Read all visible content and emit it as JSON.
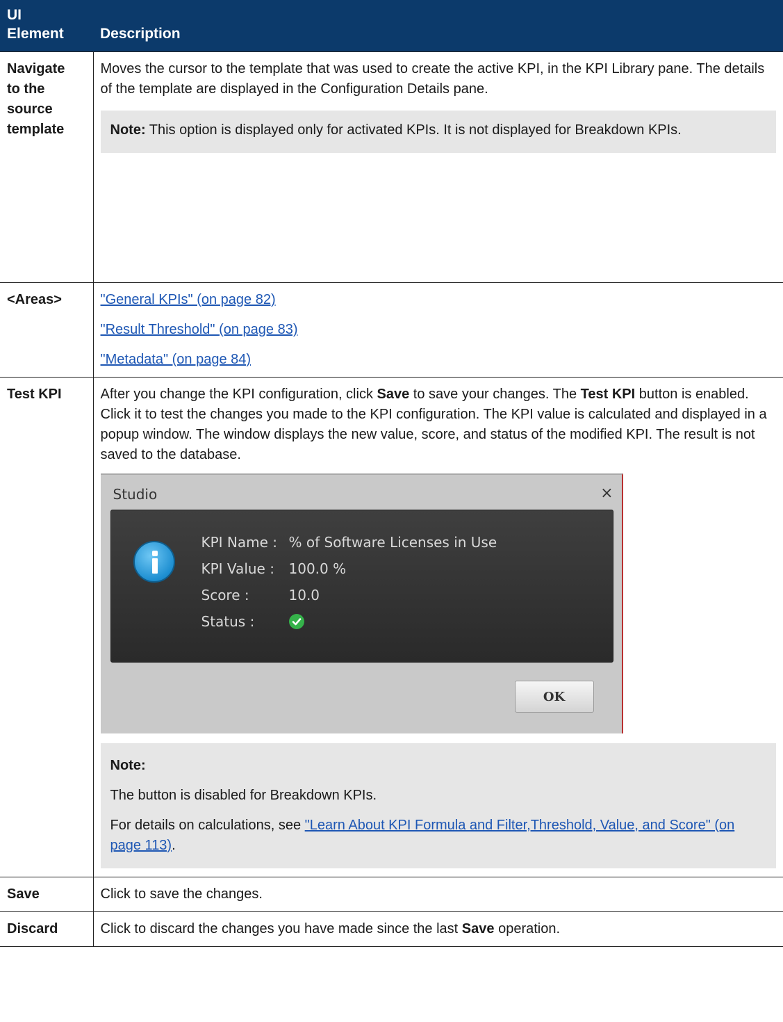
{
  "header": {
    "col1_line1": "UI",
    "col1_line2": "Element",
    "col2": "Description"
  },
  "rows": {
    "navigate": {
      "el": [
        "Navigate",
        "to the",
        "source",
        "template"
      ],
      "desc": "Moves the cursor to the template that was used to create the active KPI, in the KPI Library pane. The details of the template are displayed in the Configuration Details pane.",
      "note_label": "Note:",
      "note_text": " This option is displayed only for activated KPIs. It is not displayed for Breakdown KPIs."
    },
    "areas": {
      "el": "<Areas>",
      "links": [
        "\"General KPIs\" (on page 82)",
        "\"Result Threshold\" (on page 83)",
        "\"Metadata\" (on page 84)"
      ]
    },
    "test_kpi": {
      "el": "Test KPI",
      "desc_1": "After you change the KPI configuration, click ",
      "desc_save": "Save",
      "desc_2": " to save your changes. The ",
      "desc_testkpi": "Test KPI",
      "desc_3": " button is enabled. Click it to test the changes you made to the KPI configuration. The KPI value is calculated and displayed in a popup window. The window displays the new value, score, and status of the modified KPI. The result is not saved to the database.",
      "dialog": {
        "title": "Studio",
        "close": "×",
        "kpi_name_label": "KPI Name :",
        "kpi_name_value": "% of Software Licenses in Use",
        "kpi_value_label": "KPI Value :",
        "kpi_value_value": "100.0 %",
        "score_label": "Score :",
        "score_value": "10.0",
        "status_label": "Status :",
        "ok": "OK"
      },
      "note_label": "Note:",
      "note_line1": "The button is disabled for Breakdown KPIs.",
      "note_line2_pre": "For details on calculations, see ",
      "note_link": "\"Learn About KPI Formula and Filter,Threshold, Value, and Score\" (on page 113)",
      "note_line2_post": "."
    },
    "save": {
      "el": "Save",
      "desc": "Click to save the changes."
    },
    "discard": {
      "el": "Discard",
      "desc_1": "Click to discard the changes you have made since the last ",
      "desc_save": "Save",
      "desc_2": " operation."
    }
  }
}
